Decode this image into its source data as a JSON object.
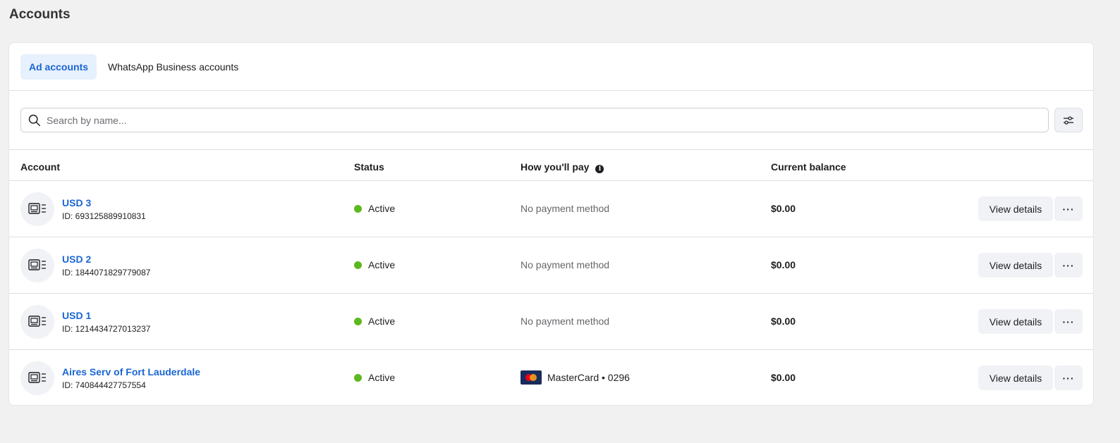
{
  "page": {
    "title": "Accounts"
  },
  "tabs": [
    {
      "label": "Ad accounts",
      "active": true
    },
    {
      "label": "WhatsApp Business accounts",
      "active": false
    }
  ],
  "search": {
    "placeholder": "Search by name..."
  },
  "table": {
    "headers": {
      "account": "Account",
      "status": "Status",
      "pay": "How you'll pay",
      "balance": "Current balance"
    },
    "rows": [
      {
        "name": "USD 3",
        "id": "ID: 693125889910831",
        "status": "Active",
        "payment": "No payment method",
        "balance": "$0.00",
        "view_label": "View details",
        "more_label": "···"
      },
      {
        "name": "USD 2",
        "id": "ID: 1844071829779087",
        "status": "Active",
        "payment": "No payment method",
        "balance": "$0.00",
        "view_label": "View details",
        "more_label": "···"
      },
      {
        "name": "USD 1",
        "id": "ID: 1214434727013237",
        "status": "Active",
        "payment": "No payment method",
        "balance": "$0.00",
        "view_label": "View details",
        "more_label": "···"
      },
      {
        "name": "Aires Serv of Fort Lauderdale",
        "id": "ID: 740844427757554",
        "status": "Active",
        "payment": "MasterCard • 0296",
        "balance": "$0.00",
        "view_label": "View details",
        "more_label": "···"
      }
    ]
  },
  "colors": {
    "accent": "#1a66d2",
    "active_status": "#5cb81d",
    "tab_active_bg": "#e7f0fd"
  },
  "icons": {
    "search": "search-icon",
    "filter": "filter-sliders-icon",
    "account": "ad-account-icon",
    "info": "info-icon",
    "card": "mastercard-icon",
    "more": "more-horizontal-icon"
  }
}
